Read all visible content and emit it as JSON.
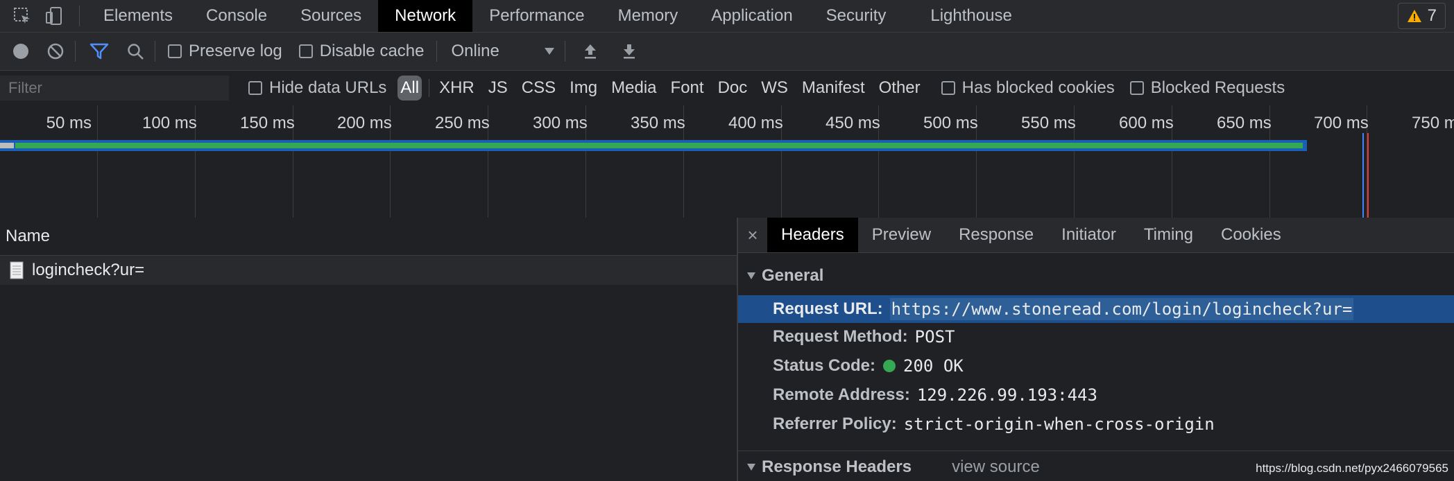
{
  "tabbar": {
    "tabs": [
      "Elements",
      "Console",
      "Sources",
      "Network",
      "Performance",
      "Memory",
      "Application",
      "Security",
      "Lighthouse"
    ],
    "active": "Network",
    "warning_count": "7"
  },
  "toolbar": {
    "preserve_log": "Preserve log",
    "disable_cache": "Disable cache",
    "throttling": "Online"
  },
  "filterbar": {
    "placeholder": "Filter",
    "hide_data_urls": "Hide data URLs",
    "types": [
      "All",
      "XHR",
      "JS",
      "CSS",
      "Img",
      "Media",
      "Font",
      "Doc",
      "WS",
      "Manifest",
      "Other"
    ],
    "has_blocked_cookies": "Has blocked cookies",
    "blocked_requests": "Blocked Requests"
  },
  "timeline": {
    "ticks": [
      "50 ms",
      "100 ms",
      "150 ms",
      "200 ms",
      "250 ms",
      "300 ms",
      "350 ms",
      "400 ms",
      "450 ms",
      "500 ms",
      "550 ms",
      "600 ms",
      "650 ms",
      "700 ms",
      "750 ms"
    ]
  },
  "requests": {
    "column_name": "Name",
    "rows": [
      {
        "name": "logincheck?ur="
      }
    ]
  },
  "details": {
    "tabs": [
      "Headers",
      "Preview",
      "Response",
      "Initiator",
      "Timing",
      "Cookies"
    ],
    "active": "Headers",
    "general_title": "General",
    "general": [
      {
        "key": "Request URL:",
        "value": "https://www.stoneread.com/login/logincheck?ur="
      },
      {
        "key": "Request Method:",
        "value": "POST"
      },
      {
        "key": "Status Code:",
        "value": "200 OK"
      },
      {
        "key": "Remote Address:",
        "value": "129.226.99.193:443"
      },
      {
        "key": "Referrer Policy:",
        "value": "strict-origin-when-cross-origin"
      }
    ],
    "response_headers_title": "Response Headers",
    "view_source": "view source"
  },
  "watermark": "https://blog.csdn.net/pyx2466079565",
  "colors": {
    "accent": "#1a73e8",
    "status_ok": "#34a853",
    "selected_row": "#1e4f8c",
    "load_line": "#e53935",
    "dom_line": "#4285f4"
  }
}
